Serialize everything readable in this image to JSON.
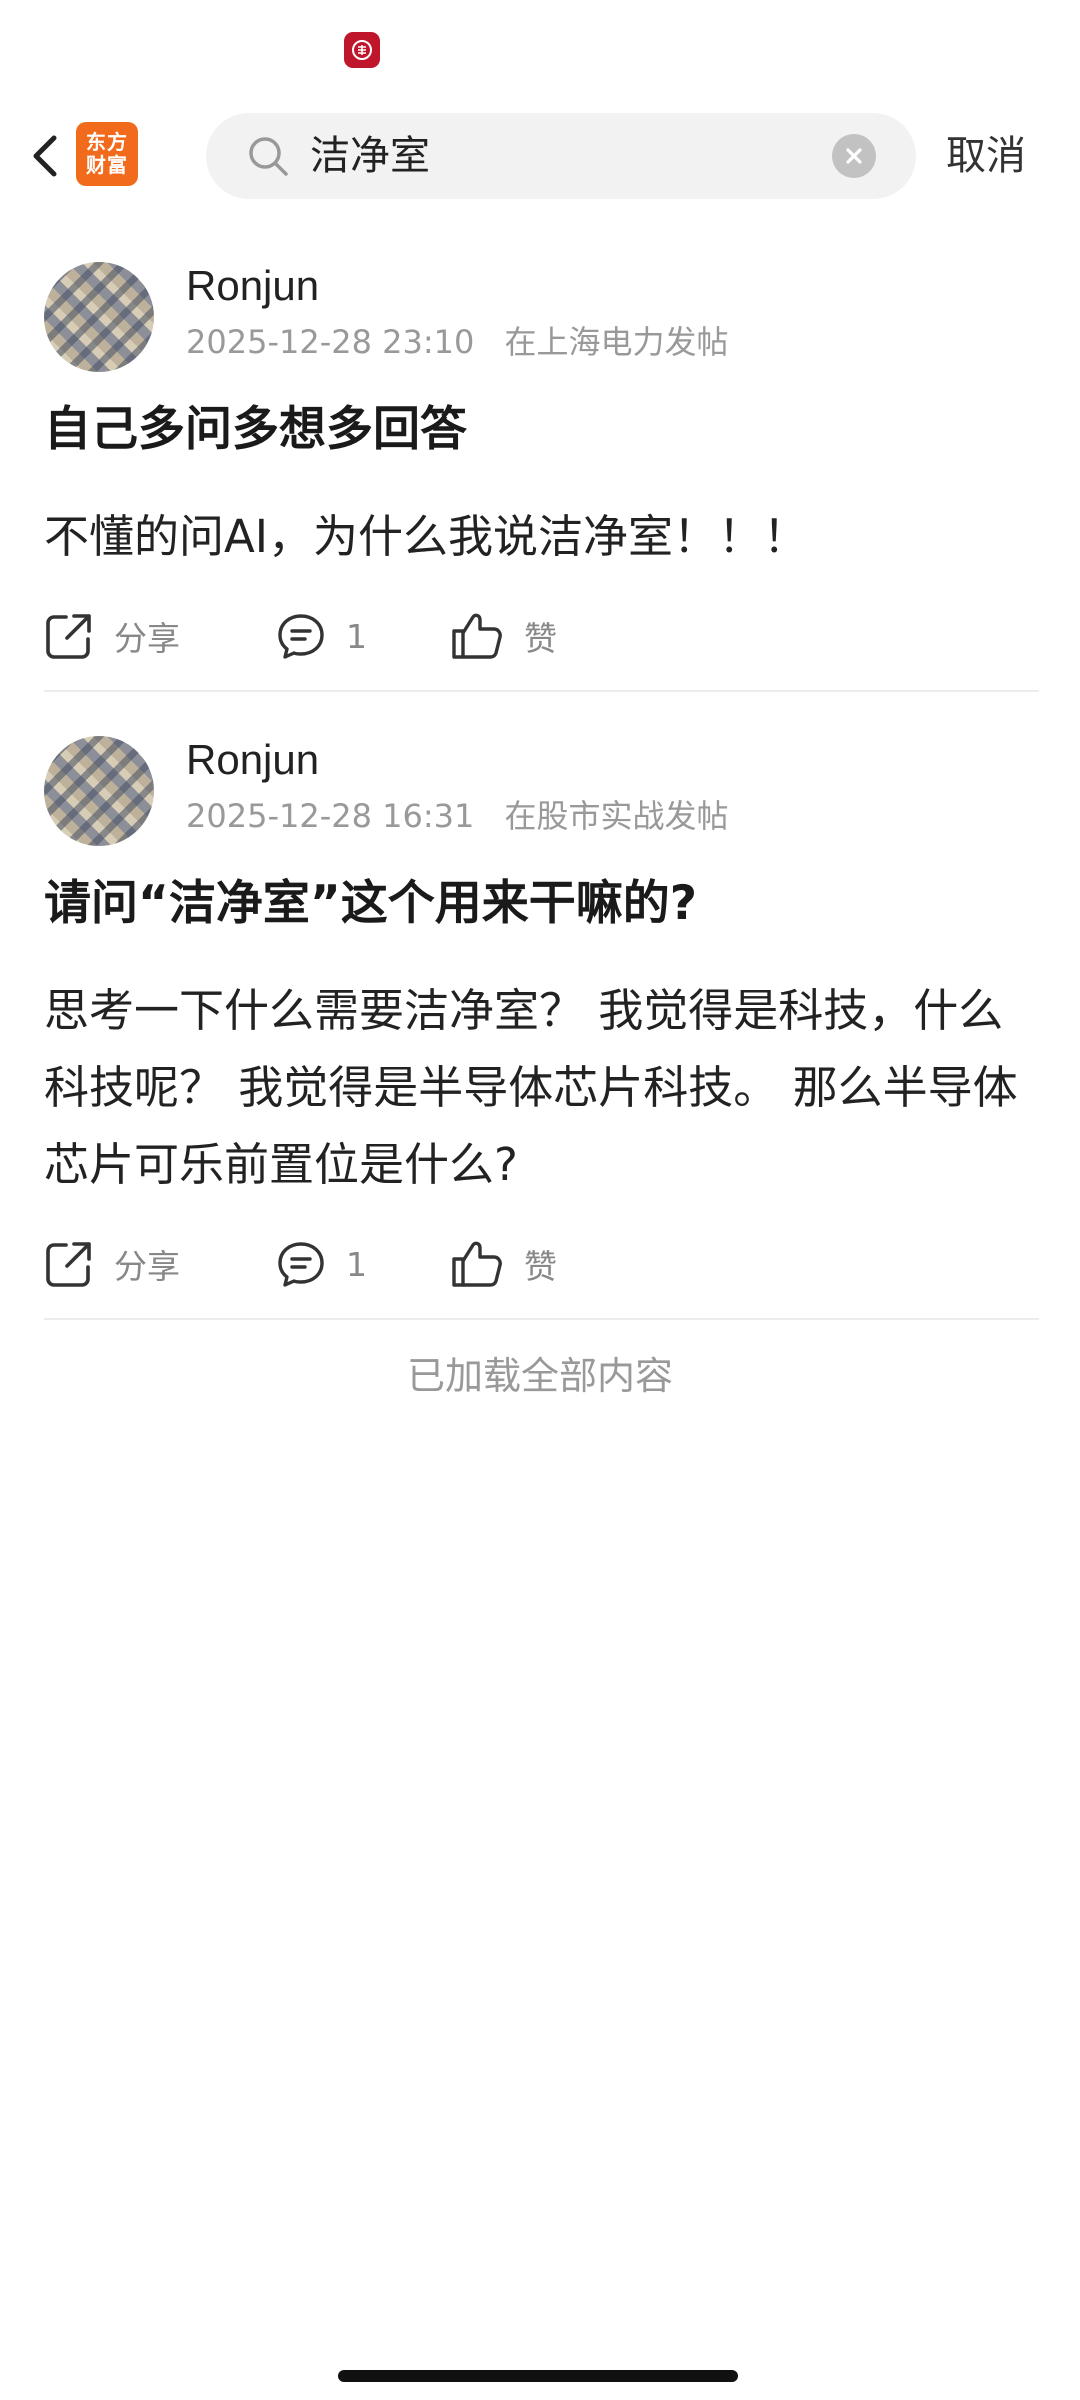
{
  "header": {
    "logo_line1": "东方",
    "logo_line2": "财富",
    "search": {
      "query": "洁净室"
    },
    "cancel_label": "取消"
  },
  "posts": [
    {
      "author": "Ronjun",
      "timestamp": "2025-12-28 23:10",
      "board": "在上海电力发帖",
      "title": "自己多问多想多回答",
      "body": "不懂的问AI，为什么我说洁净室！！！",
      "share_label": "分享",
      "comment_count": "1",
      "like_label": "赞"
    },
    {
      "author": "Ronjun",
      "timestamp": "2025-12-28 16:31",
      "board": "在股市实战发帖",
      "title": "请问“洁净室”这个用来干嘛的?",
      "body": "思考一下什么需要洁净室？ 我觉得是科技，什么科技呢？ 我觉得是半导体芯片科技。 那么半导体芯片可乐前置位是什么?",
      "share_label": "分享",
      "comment_count": "1",
      "like_label": "赞"
    }
  ],
  "footer": {
    "load_all_text": "已加载全部内容"
  },
  "colors": {
    "brand_orange": "#f26b1d",
    "status_icon_red": "#c0162c",
    "meta_gray": "#999999"
  },
  "icons": {
    "status": "app-notification-icon",
    "back": "chevron-left-icon",
    "search": "search-icon",
    "clear": "clear-icon",
    "share": "share-icon",
    "comment": "comment-icon",
    "like": "thumbs-up-icon"
  }
}
